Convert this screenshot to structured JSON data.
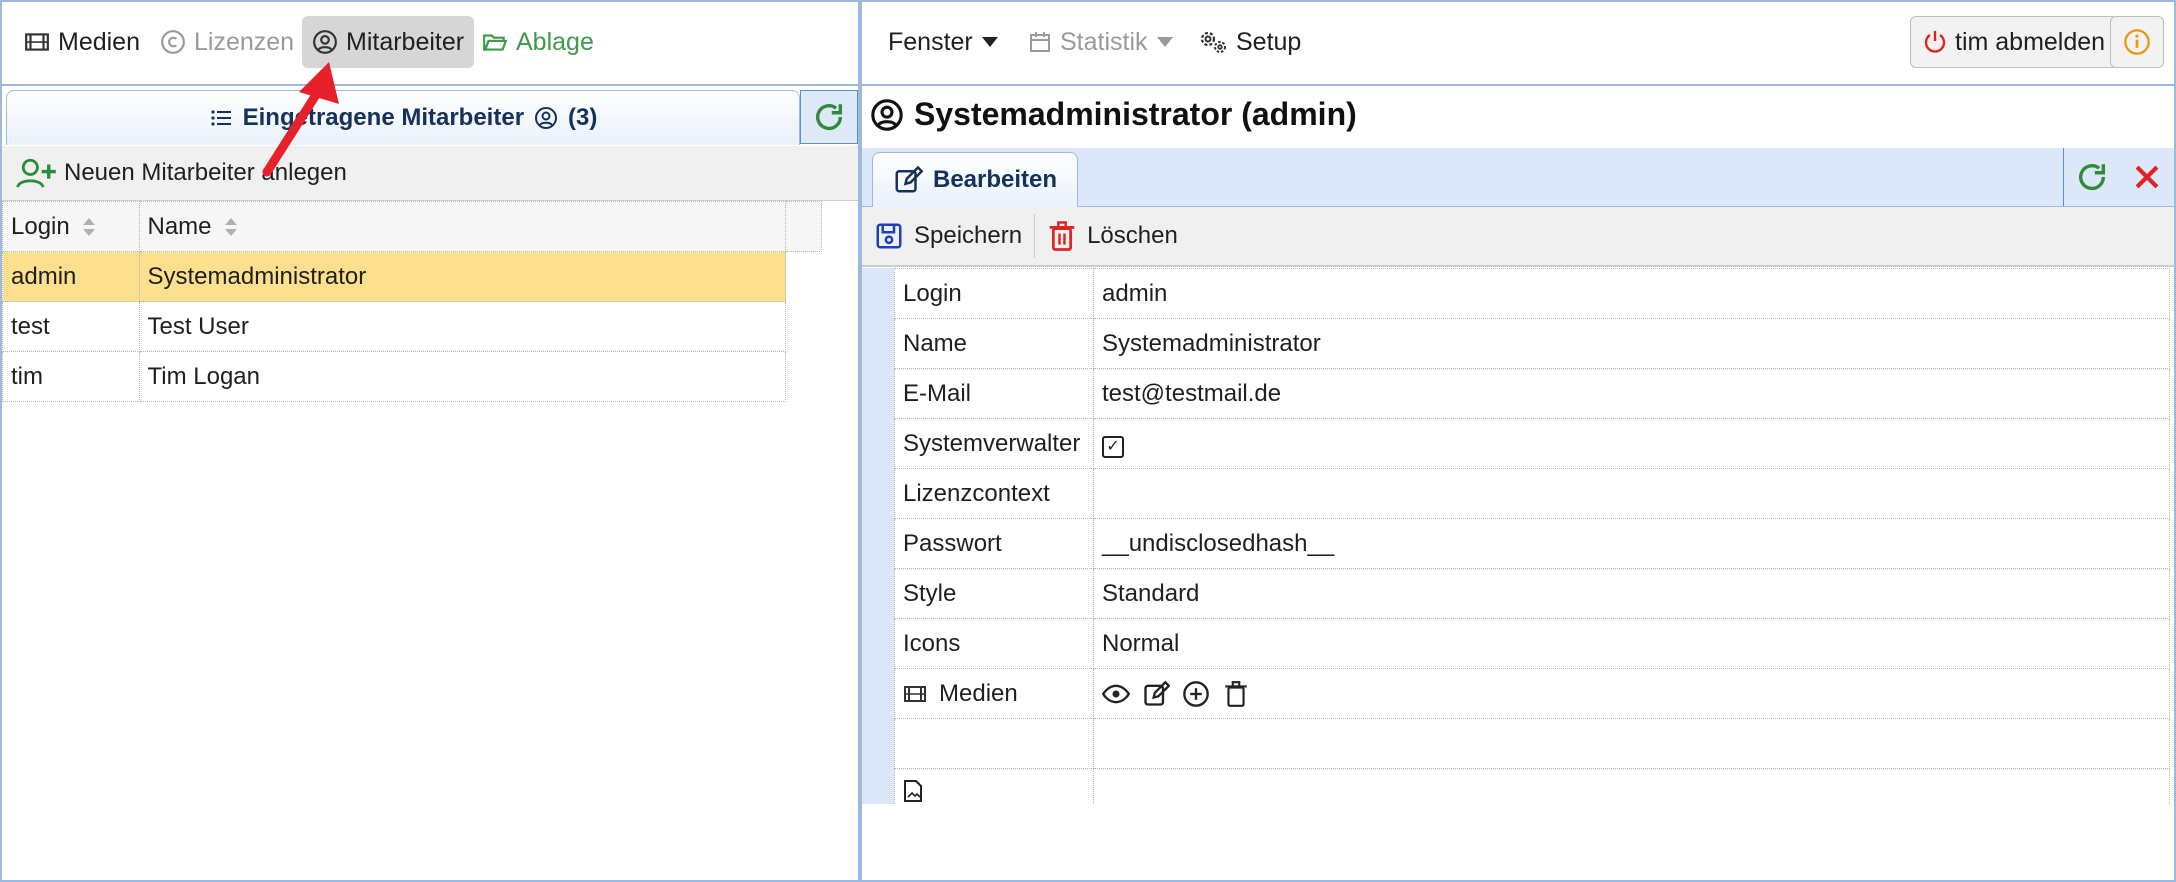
{
  "left_menu": {
    "medien": "Medien",
    "lizenzen": "Lizenzen",
    "mitarbeiter": "Mitarbeiter",
    "ablage": "Ablage"
  },
  "left_tab": {
    "title": "Eingetragene Mitarbeiter",
    "count": "(3)"
  },
  "left_toolbar": {
    "new_employee": "Neuen Mitarbeiter anlegen"
  },
  "employee_table": {
    "columns": [
      "Login",
      "Name"
    ],
    "rows": [
      {
        "login": "admin",
        "name": "Systemadministrator",
        "selected": true
      },
      {
        "login": "test",
        "name": "Test User",
        "selected": false
      },
      {
        "login": "tim",
        "name": "Tim Logan",
        "selected": false
      }
    ]
  },
  "right_menu": {
    "fenster": "Fenster",
    "statistik": "Statistik",
    "setup": "Setup",
    "logout": "tim abmelden"
  },
  "detail": {
    "title": "Systemadministrator (admin)",
    "tab_edit": "Bearbeiten",
    "save": "Speichern",
    "delete": "Löschen",
    "fields": [
      {
        "label": "Login",
        "value": "admin"
      },
      {
        "label": "Name",
        "value": "Systemadministrator"
      },
      {
        "label": "E-Mail",
        "value": "test@testmail.de"
      },
      {
        "label": "Systemverwalter",
        "value": "checked"
      },
      {
        "label": "Lizenzcontext",
        "value": ""
      },
      {
        "label": "Passwort",
        "value": "__undisclosedhash__"
      },
      {
        "label": "Style",
        "value": "Standard"
      },
      {
        "label": "Icons",
        "value": "Normal"
      },
      {
        "label": "Medien",
        "value": ""
      }
    ]
  },
  "colors": {
    "border_blue": "#9db9dd",
    "selected_row": "#fde08d",
    "green": "#3f9a4b",
    "red": "#e02424",
    "navy": "#15325b"
  }
}
